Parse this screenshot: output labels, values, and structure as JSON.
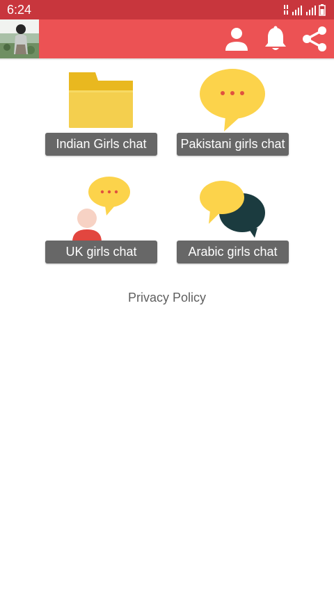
{
  "status_bar": {
    "time": "6:24",
    "icons": [
      "data-arrows-icon",
      "signal-icon",
      "signal-icon",
      "battery-icon"
    ]
  },
  "app_bar": {
    "color": "#ec5254",
    "icons": [
      "avatar",
      "person-icon",
      "bell-icon",
      "share-icon"
    ]
  },
  "tiles": [
    {
      "label": "Indian Girls chat",
      "icon": "folder-icon"
    },
    {
      "label": "Pakistani girls chat",
      "icon": "speech-bubble-icon"
    },
    {
      "label": "UK girls chat",
      "icon": "person-chat-icon"
    },
    {
      "label": "Arabic girls chat",
      "icon": "conversation-bubbles-icon"
    }
  ],
  "footer": {
    "privacy_label": "Privacy Policy"
  },
  "colors": {
    "status_bar": "#c8363d",
    "button": "#676767",
    "accent_yellow": "#fcd34b",
    "dark_teal": "#1b3b3f"
  }
}
